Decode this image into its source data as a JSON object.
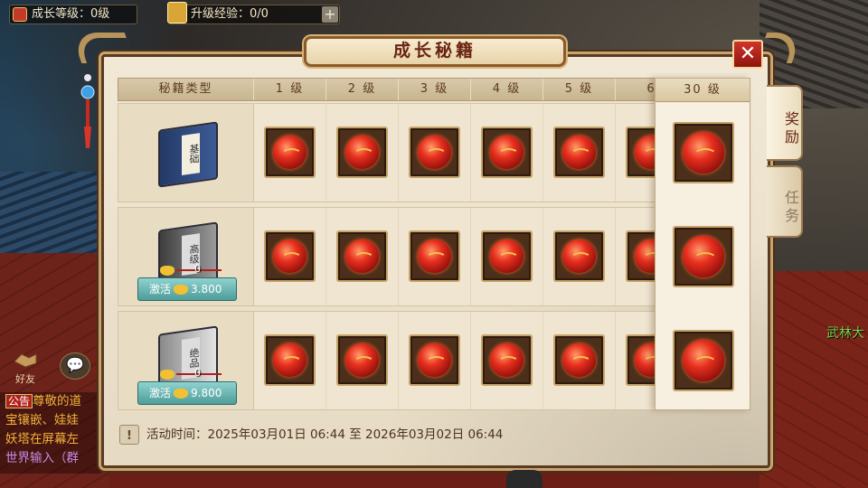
{
  "hud": {
    "growth_level": "成长等级：0级",
    "exp_icon_label": "经验",
    "exp_text": "升级经验：0/0",
    "plus": "+"
  },
  "chat": {
    "friend_label": "好友",
    "chat_icon": "speech-bubble-icon",
    "notice_tag": "公告",
    "line1": "尊敬的道",
    "line2": "宝镶嵌、娃娃",
    "line3": "妖塔在屏幕左",
    "line4": "世界输入（群"
  },
  "scene": {
    "right_label": "武林大"
  },
  "panel": {
    "title": "成长秘籍",
    "close": "✕",
    "tabs": [
      "奖励",
      "任务"
    ],
    "active_tab": "奖励",
    "header": [
      "秘籍类型",
      "1 级",
      "2 级",
      "3 级",
      "4 级",
      "5 级",
      "6"
    ],
    "header_30": "30 级",
    "rows": [
      {
        "book_label": "基础",
        "book_color": "blue",
        "original_price": "",
        "activate_text": "",
        "activate_price": ""
      },
      {
        "book_label": "高级",
        "book_color": "dark-silver",
        "original_price": "0",
        "activate_text": "激活",
        "activate_price": "3.800"
      },
      {
        "book_label": "绝品",
        "book_color": "silver",
        "original_price": "0",
        "activate_text": "激活",
        "activate_price": "9.800"
      }
    ],
    "reward_icon": "red-orb-icon",
    "footer": "活动时间：2025年03月01日 06:44 至 2026年03月02日 06:44",
    "footer_icon": "!"
  },
  "colors": {
    "title": "#6a2510",
    "activate_button": "#5fb3b0",
    "close_button": "#c0281f"
  }
}
